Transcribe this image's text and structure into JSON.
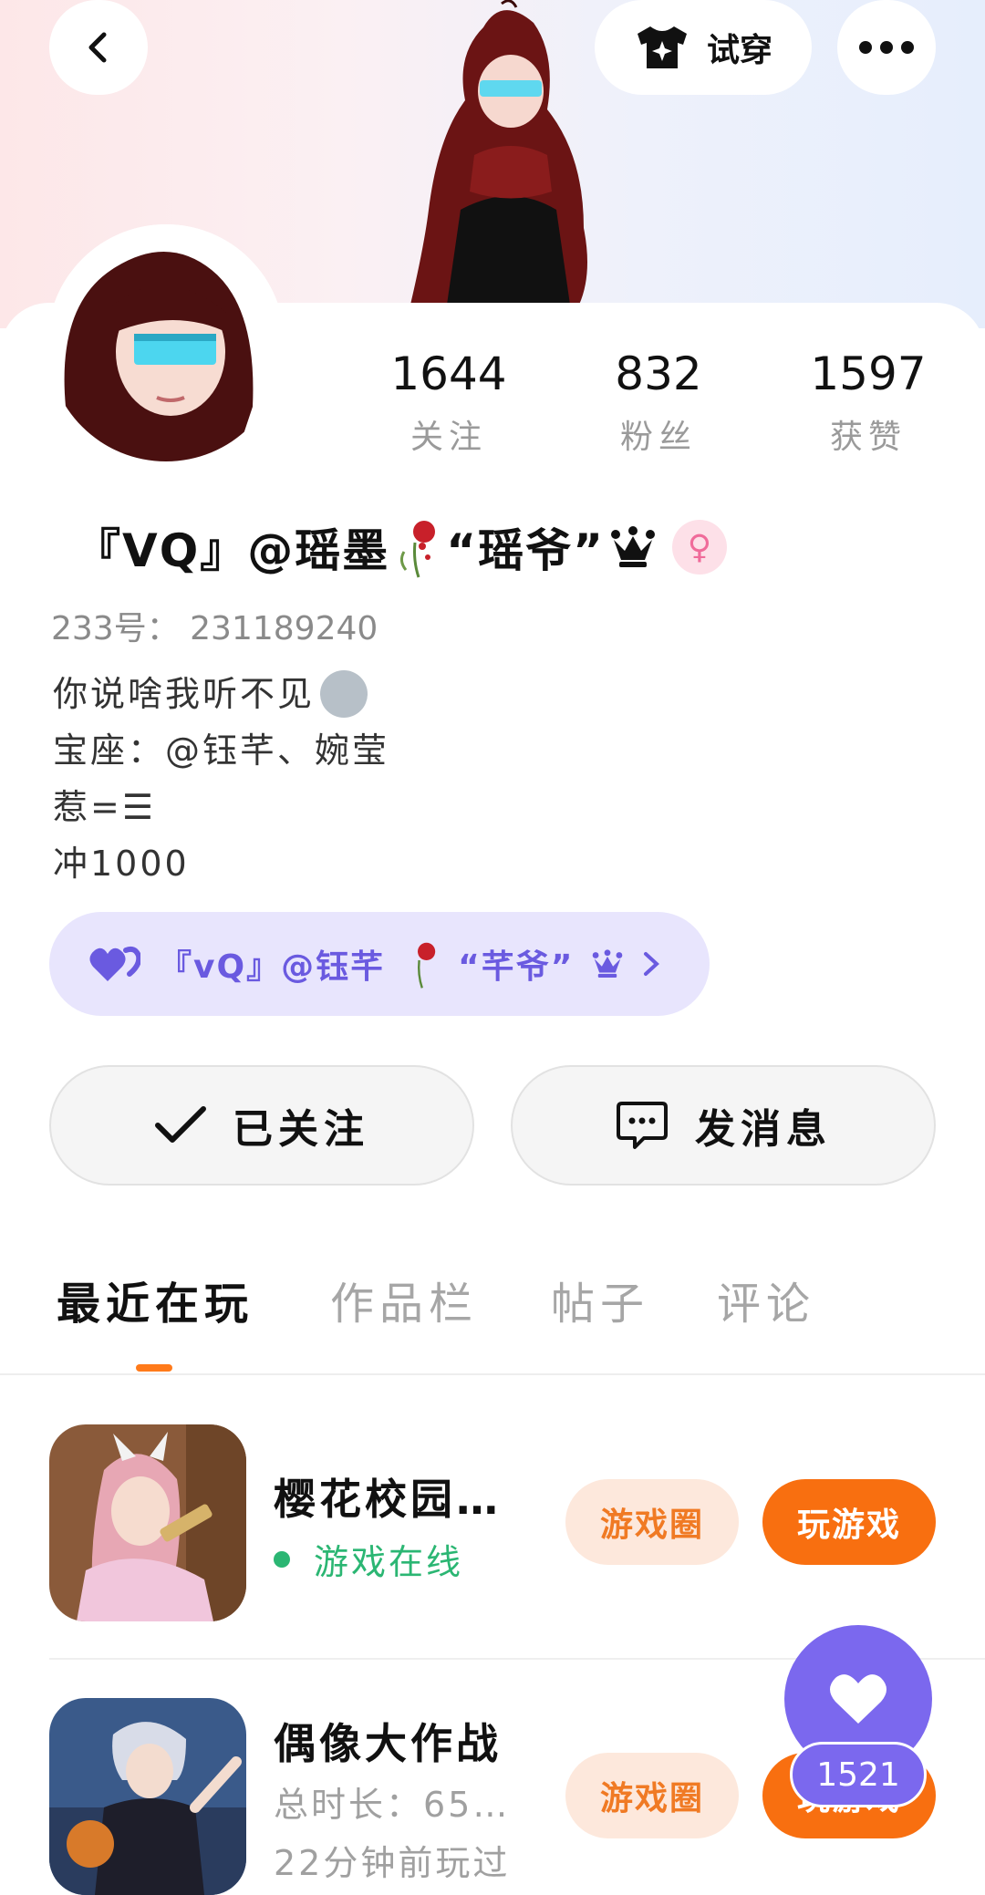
{
  "header": {
    "tryon_label": "试穿",
    "icons": {
      "back": "chevron-left-icon",
      "tryon": "tshirt-icon",
      "more": "more-dots-icon"
    }
  },
  "stats": [
    {
      "value": "1644",
      "label": "关注"
    },
    {
      "value": "832",
      "label": "粉丝"
    },
    {
      "value": "1597",
      "label": "获赞"
    }
  ],
  "profile": {
    "name": "『VQ』@瑶墨",
    "nickname": "“瑶爷”",
    "gender_symbol": "♀",
    "uid": "233号： 231189240",
    "bio": [
      "你说啥我听不见",
      "宝座：@钰芊、婉莹",
      "惹=☰",
      "冲1000"
    ]
  },
  "couple": {
    "text_a": "『vQ』@钰芊",
    "text_b": "“芊爷”"
  },
  "actions": {
    "follow_label": "已关注",
    "message_label": "发消息"
  },
  "tabs": [
    "最近在玩",
    "作品栏",
    "帖子",
    "评论"
  ],
  "games": [
    {
      "title": "樱花校园…",
      "status": "游戏在线",
      "status_color": "#2bb673",
      "circle_label": "游戏圈",
      "play_label": "玩游戏"
    },
    {
      "title": "偶像大作战",
      "meta1": "总时长：65…",
      "meta2": "22分钟前玩过",
      "circle_label": "游戏圈",
      "play_label": "玩游戏"
    }
  ],
  "like": {
    "count": "1521"
  },
  "colors": {
    "accent": "#f86f10",
    "purple": "#7b68ee",
    "online": "#2bb673"
  }
}
